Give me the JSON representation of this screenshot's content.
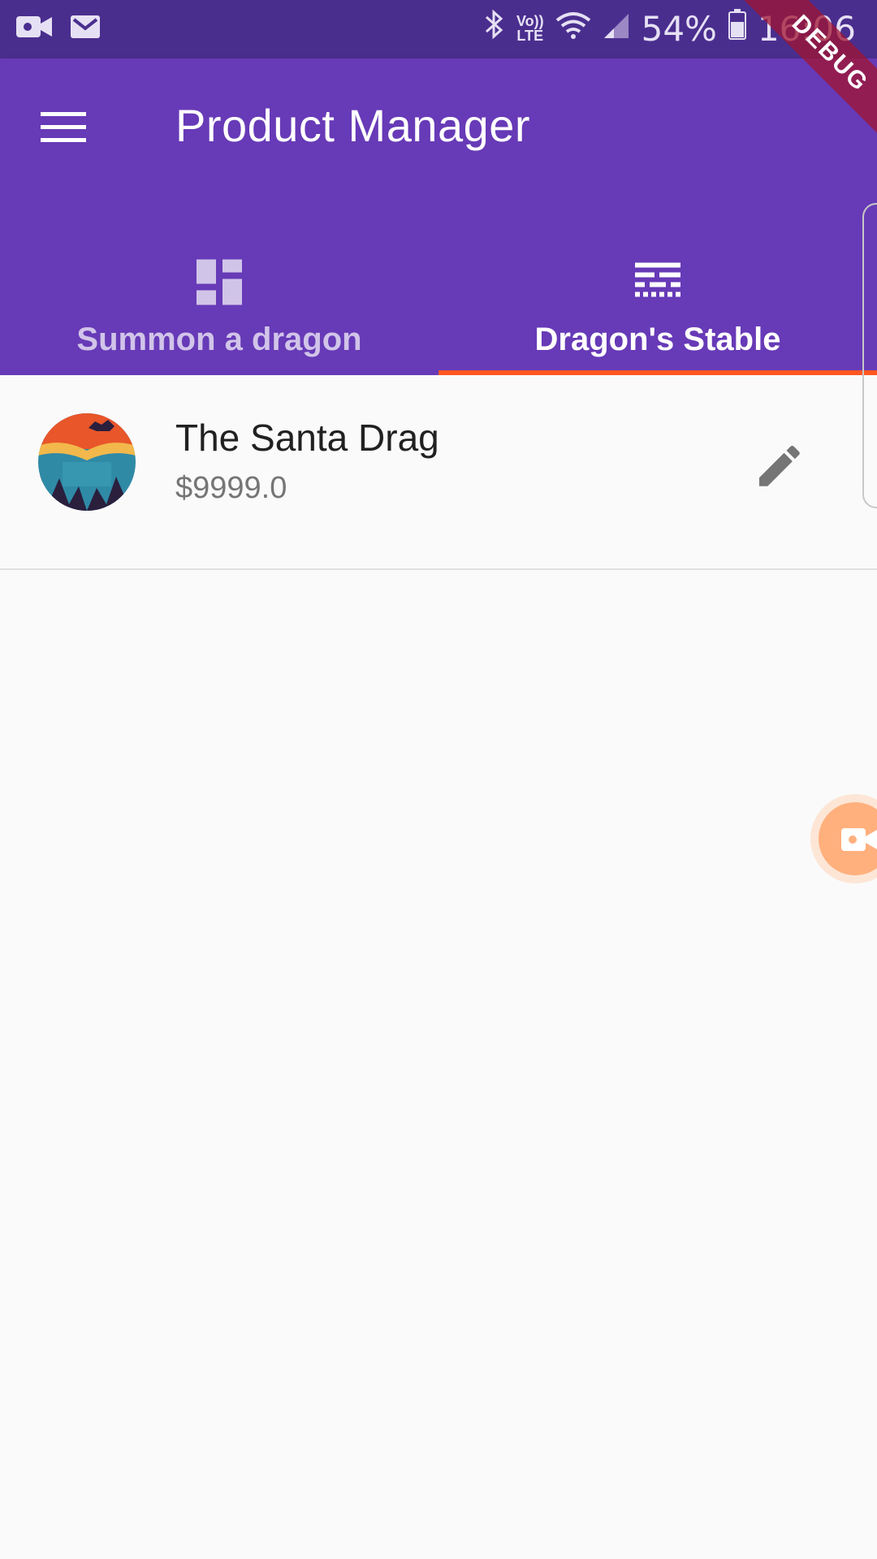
{
  "status_bar": {
    "battery": "54%",
    "time": "16:06",
    "volte_top": "Vo))",
    "volte_bottom": "LTE"
  },
  "app_bar": {
    "title": "Product Manager",
    "background": "#673ab7",
    "status_background": "#4a2e8e"
  },
  "tabs": [
    {
      "label": "Summon a dragon",
      "icon": "dashboard-icon",
      "selected": false
    },
    {
      "label": "Dragon's Stable",
      "icon": "storage-icon",
      "selected": true
    }
  ],
  "tab_indicator_color": "#ff5722",
  "products": [
    {
      "title": "The Santa Drag",
      "price": "$9999.0",
      "action_icon": "edit-icon"
    }
  ],
  "debug_banner": "DEBUG"
}
